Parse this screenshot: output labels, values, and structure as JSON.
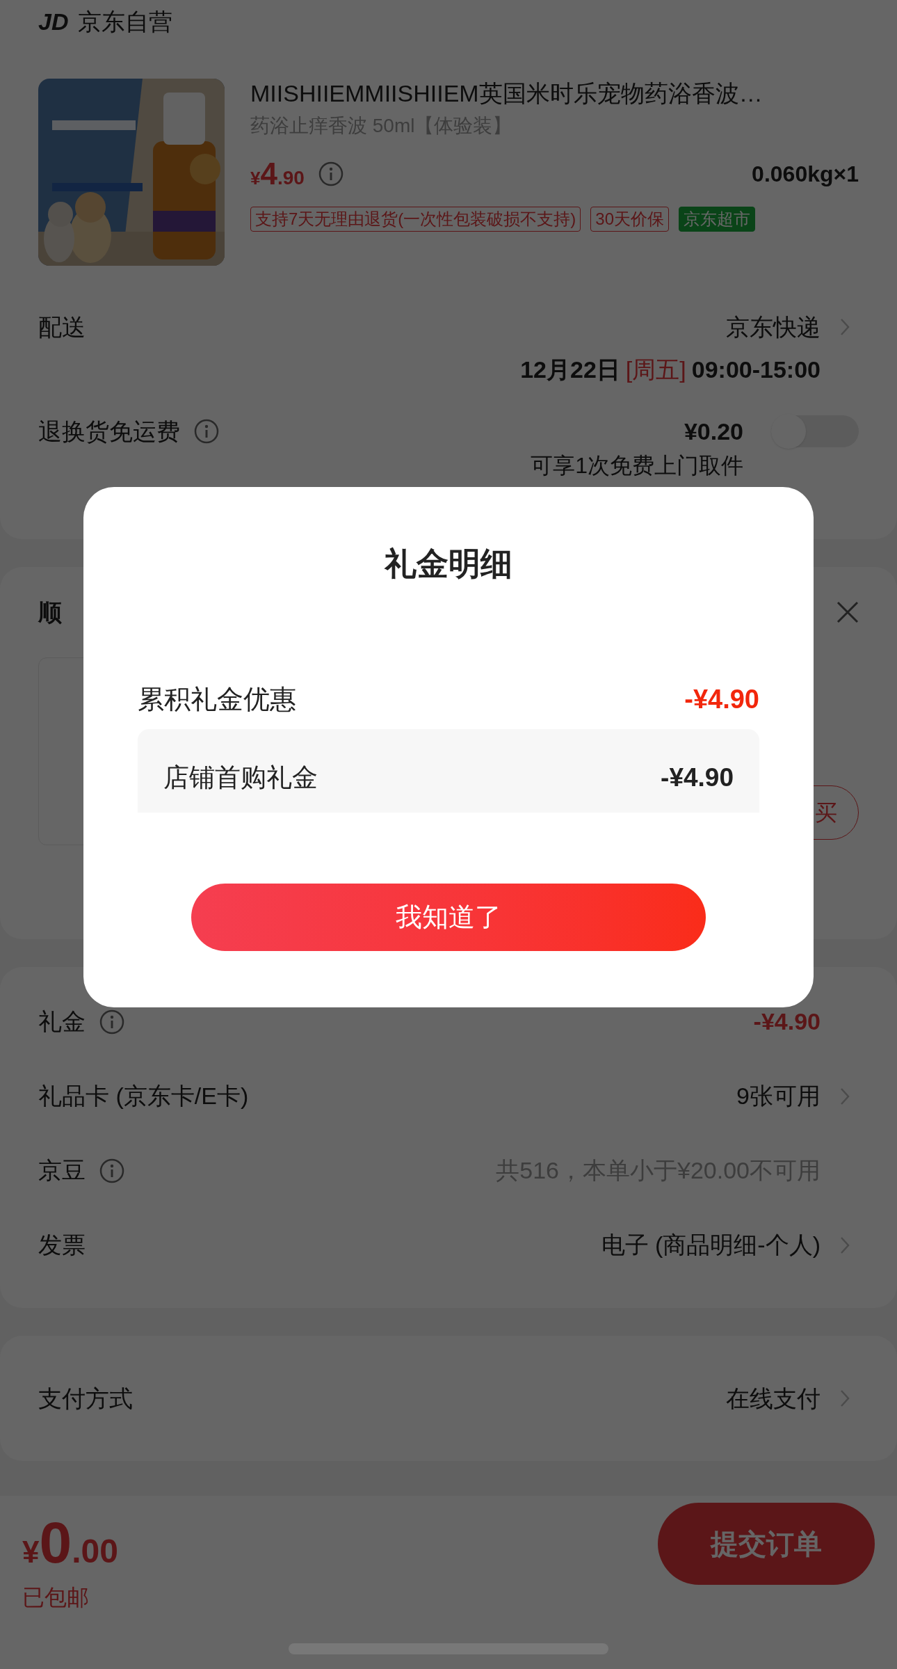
{
  "shop": {
    "logo": "JD",
    "name": "京东自营"
  },
  "product": {
    "title": "MIISHIIEMMIISHIIEM英国米时乐宠物药浴香波…",
    "spec": "药浴止痒香波 50ml【体验装】",
    "price_symbol": "¥",
    "price_int": "4",
    "price_dec": ".90",
    "weight": "0.060kg×1",
    "tags": [
      {
        "text": "支持7天无理由退货(一次性包装破损不支持)",
        "kind": "outline"
      },
      {
        "text": "30天价保",
        "kind": "outline"
      },
      {
        "text": "京东超市",
        "kind": "filled"
      }
    ]
  },
  "delivery": {
    "label": "配送",
    "value": "京东快递",
    "date": "12月22日",
    "weekday": "[周五]",
    "time": "09:00-15:00"
  },
  "return_shipping": {
    "label": "退换货免运费",
    "price": "¥0.20",
    "note": "可享1次免费上门取件",
    "on": false
  },
  "addon": {
    "title": "顺",
    "button": "买"
  },
  "discounts": [
    {
      "label": "礼金",
      "info": true,
      "value": "-¥4.90",
      "kind": "red",
      "chevron": false
    },
    {
      "label": "礼品卡 (京东卡/E卡)",
      "info": false,
      "value": "9张可用",
      "kind": "plain",
      "chevron": true
    },
    {
      "label": "京豆",
      "info": true,
      "value": "共516，本单小于¥20.00不可用",
      "kind": "muted",
      "chevron": false
    },
    {
      "label": "发票",
      "info": false,
      "value": "电子 (商品明细-个人)",
      "kind": "plain",
      "chevron": true
    }
  ],
  "payment": {
    "label": "支付方式",
    "value": "在线支付"
  },
  "footer": {
    "symbol": "¥",
    "int": "0",
    "dec": ".00",
    "shipping": "已包邮",
    "submit": "提交订单"
  },
  "modal": {
    "title": "礼金明细",
    "total_label": "累积礼金优惠",
    "total_value": "-¥4.90",
    "items": [
      {
        "label": "店铺首购礼金",
        "value": "-¥4.90"
      }
    ],
    "button": "我知道了"
  }
}
